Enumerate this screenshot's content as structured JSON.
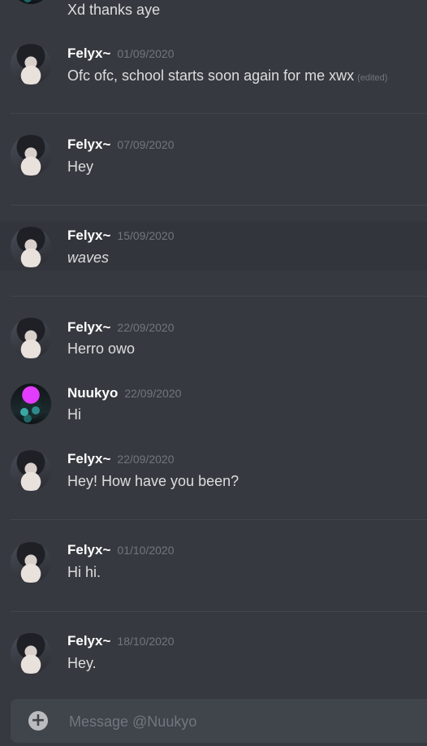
{
  "messages": [
    {
      "author": "",
      "timestamp": "",
      "content": "Xd thanks aye",
      "avatar": "nuukyo-avatar"
    },
    {
      "author": "Felyx~",
      "timestamp": "01/09/2020",
      "content": "Ofc ofc, school starts soon again for me xwx",
      "edited": "(edited)",
      "avatar": "felyx-avatar"
    },
    {
      "author": "Felyx~",
      "timestamp": "07/09/2020",
      "content": "Hey",
      "avatar": "felyx-avatar"
    },
    {
      "author": "Felyx~",
      "timestamp": "15/09/2020",
      "content": "waves",
      "avatar": "felyx-avatar"
    },
    {
      "author": "Felyx~",
      "timestamp": "22/09/2020",
      "content": "Herro owo",
      "avatar": "felyx-avatar"
    },
    {
      "author": "Nuukyo",
      "timestamp": "22/09/2020",
      "content": "Hi",
      "avatar": "nuukyo-avatar"
    },
    {
      "author": "Felyx~",
      "timestamp": "22/09/2020",
      "content": "Hey! How have you been?",
      "avatar": "felyx-avatar"
    },
    {
      "author": "Felyx~",
      "timestamp": "01/10/2020",
      "content": "Hi hi.",
      "avatar": "felyx-avatar"
    },
    {
      "author": "Felyx~",
      "timestamp": "18/10/2020",
      "content": "Hey.",
      "avatar": "felyx-avatar"
    }
  ],
  "composer": {
    "placeholder": "Message @Nuukyo",
    "attach_icon": "plus-circle-icon"
  },
  "colors": {
    "background": "#36393f",
    "hover_row": "#32353b",
    "composer": "#40444b",
    "author": "#ffffff",
    "timestamp": "#72767d",
    "text": "#dcddde"
  }
}
